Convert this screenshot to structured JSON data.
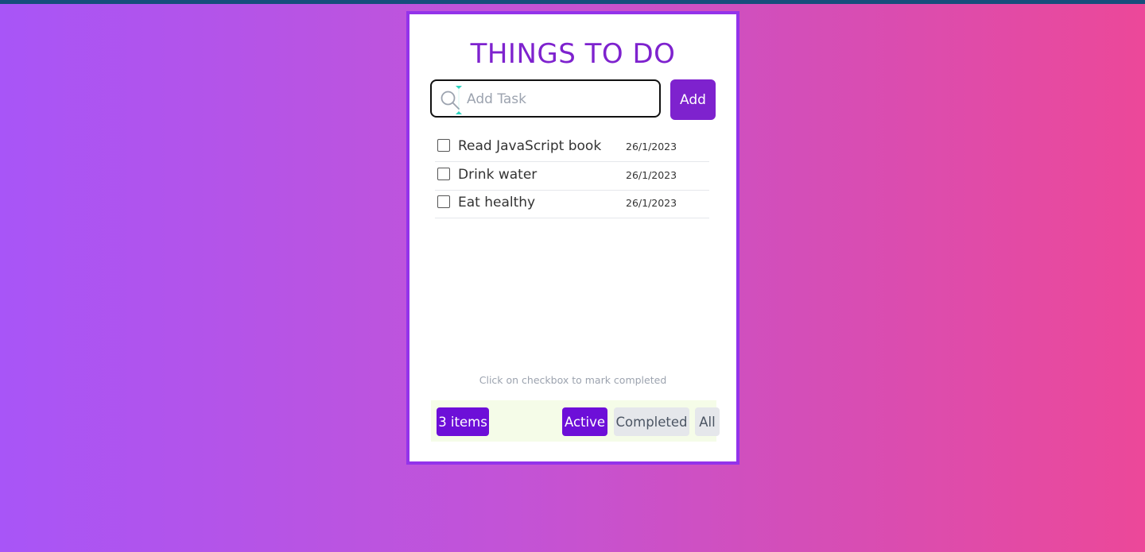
{
  "app": {
    "title": "THINGS TO DO",
    "accent_color": "#7e22ce"
  },
  "input": {
    "placeholder": "Add Task",
    "value": "",
    "icon": "search-icon"
  },
  "add_button": {
    "label": "Add"
  },
  "tasks": [
    {
      "text": "Read JavaScript book",
      "date": "26/1/2023",
      "completed": false
    },
    {
      "text": "Drink water",
      "date": "26/1/2023",
      "completed": false
    },
    {
      "text": "Eat healthy",
      "date": "26/1/2023",
      "completed": false
    }
  ],
  "hint": "Click on checkbox to mark completed",
  "footer": {
    "count_label": "3 items",
    "filters": [
      {
        "label": "Active",
        "selected": true
      },
      {
        "label": "Completed",
        "selected": false
      },
      {
        "label": "All",
        "selected": false
      }
    ]
  }
}
